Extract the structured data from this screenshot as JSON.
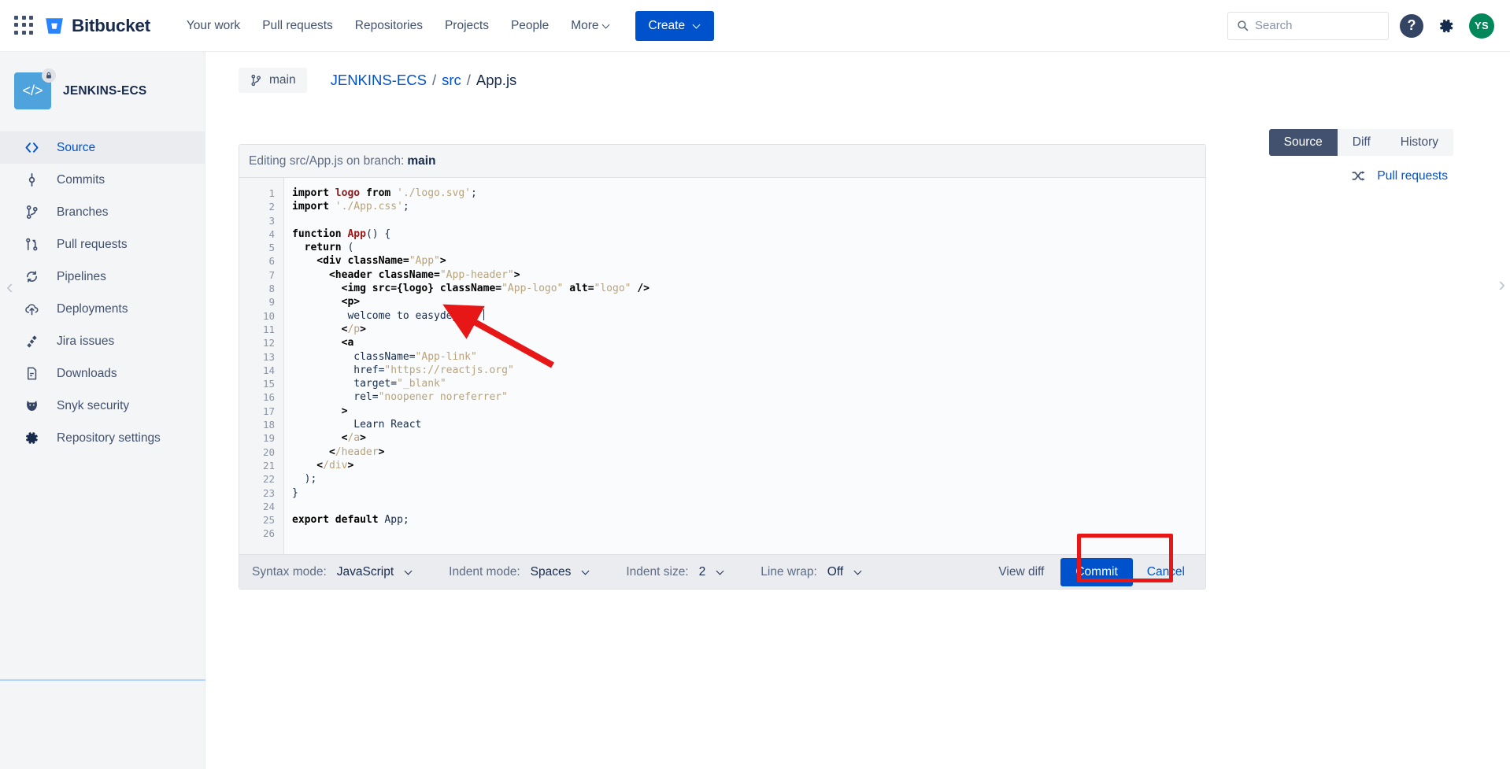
{
  "topnav": {
    "app_switcher_icon": "grid-apps-icon",
    "brand": "Bitbucket",
    "links": [
      {
        "label": "Your work"
      },
      {
        "label": "Pull requests"
      },
      {
        "label": "Repositories"
      },
      {
        "label": "Projects"
      },
      {
        "label": "People"
      },
      {
        "label": "More"
      }
    ],
    "create_label": "Create",
    "search_placeholder": "Search",
    "help_icon": "question-mark-icon",
    "settings_icon": "gear-icon",
    "avatar_initials": "YS"
  },
  "sidebar": {
    "repo_name": "JENKINS-ECS",
    "repo_avatar_glyph": "</>",
    "lock_icon": "lock-icon",
    "items": [
      {
        "label": "Source",
        "icon": "code-brackets-icon",
        "active": true
      },
      {
        "label": "Commits",
        "icon": "commit-node-icon",
        "active": false
      },
      {
        "label": "Branches",
        "icon": "branch-icon",
        "active": false
      },
      {
        "label": "Pull requests",
        "icon": "pull-request-icon",
        "active": false
      },
      {
        "label": "Pipelines",
        "icon": "pipeline-refresh-icon",
        "active": false
      },
      {
        "label": "Deployments",
        "icon": "cloud-upload-icon",
        "active": false
      },
      {
        "label": "Jira issues",
        "icon": "jira-icon",
        "active": false
      },
      {
        "label": "Downloads",
        "icon": "file-download-icon",
        "active": false
      },
      {
        "label": "Snyk security",
        "icon": "snyk-dog-icon",
        "active": false
      },
      {
        "label": "Repository settings",
        "icon": "gear-icon",
        "active": false
      }
    ]
  },
  "main": {
    "branch_label": "main",
    "branch_icon": "branch-icon",
    "breadcrumb": {
      "repo": "JENKINS-ECS",
      "folder": "src",
      "file": "App.js",
      "separator": "/"
    },
    "view_tabs": [
      {
        "label": "Source",
        "selected": true
      },
      {
        "label": "Diff",
        "selected": false
      },
      {
        "label": "History",
        "selected": false
      }
    ],
    "pull_requests_link": "Pull requests",
    "pull_requests_icon": "shuffle-arrows-icon"
  },
  "editor": {
    "header_prefix": "Editing src/App.js on branch:",
    "header_branch": "main",
    "line_numbers": [
      1,
      2,
      3,
      4,
      5,
      6,
      7,
      8,
      9,
      10,
      11,
      12,
      13,
      14,
      15,
      16,
      17,
      18,
      19,
      20,
      21,
      22,
      23,
      24,
      25,
      26
    ],
    "code_lines": [
      {
        "n": 1,
        "tokens": [
          {
            "t": "import",
            "c": "tk-kw"
          },
          {
            "t": " ",
            "c": "tk-plain"
          },
          {
            "t": "logo",
            "c": "tk-var"
          },
          {
            "t": " ",
            "c": "tk-plain"
          },
          {
            "t": "from",
            "c": "tk-kw"
          },
          {
            "t": " ",
            "c": "tk-plain"
          },
          {
            "t": "'./logo.svg'",
            "c": "tk-str"
          },
          {
            "t": ";",
            "c": "tk-plain"
          }
        ]
      },
      {
        "n": 2,
        "tokens": [
          {
            "t": "import",
            "c": "tk-kw"
          },
          {
            "t": " ",
            "c": "tk-plain"
          },
          {
            "t": "'./App.css'",
            "c": "tk-str"
          },
          {
            "t": ";",
            "c": "tk-plain"
          }
        ]
      },
      {
        "n": 3,
        "tokens": []
      },
      {
        "n": 4,
        "tokens": [
          {
            "t": "function",
            "c": "tk-kw"
          },
          {
            "t": " ",
            "c": "tk-plain"
          },
          {
            "t": "App",
            "c": "tk-fn"
          },
          {
            "t": "() {",
            "c": "tk-plain"
          }
        ]
      },
      {
        "n": 5,
        "tokens": [
          {
            "t": "  ",
            "c": "tk-plain"
          },
          {
            "t": "return",
            "c": "tk-kw"
          },
          {
            "t": " (",
            "c": "tk-plain"
          }
        ]
      },
      {
        "n": 6,
        "tokens": [
          {
            "t": "    <div className=",
            "c": "tk-tag"
          },
          {
            "t": "\"App\"",
            "c": "tk-str"
          },
          {
            "t": ">",
            "c": "tk-tag"
          }
        ]
      },
      {
        "n": 7,
        "tokens": [
          {
            "t": "      <header className=",
            "c": "tk-tag"
          },
          {
            "t": "\"App-header\"",
            "c": "tk-str"
          },
          {
            "t": ">",
            "c": "tk-tag"
          }
        ]
      },
      {
        "n": 8,
        "tokens": [
          {
            "t": "        <img src={logo} className=",
            "c": "tk-tag"
          },
          {
            "t": "\"App-logo\"",
            "c": "tk-str"
          },
          {
            "t": " alt=",
            "c": "tk-tag"
          },
          {
            "t": "\"logo\"",
            "c": "tk-str"
          },
          {
            "t": " />",
            "c": "tk-tag"
          }
        ]
      },
      {
        "n": 9,
        "tokens": [
          {
            "t": "        <p>",
            "c": "tk-tag"
          }
        ]
      },
      {
        "n": 10,
        "tokens": [
          {
            "t": "         welcome to easydeploy ",
            "c": "tk-plain"
          }
        ],
        "caret": true
      },
      {
        "n": 11,
        "tokens": [
          {
            "t": "        <",
            "c": "tk-tag"
          },
          {
            "t": "/p",
            "c": "tk-tagname"
          },
          {
            "t": ">",
            "c": "tk-tag"
          }
        ]
      },
      {
        "n": 12,
        "tokens": [
          {
            "t": "        <a",
            "c": "tk-tag"
          }
        ]
      },
      {
        "n": 13,
        "tokens": [
          {
            "t": "          className=",
            "c": "tk-attr"
          },
          {
            "t": "\"App-link\"",
            "c": "tk-str"
          }
        ]
      },
      {
        "n": 14,
        "tokens": [
          {
            "t": "          href=",
            "c": "tk-attr"
          },
          {
            "t": "\"https://reactjs.org\"",
            "c": "tk-str"
          }
        ]
      },
      {
        "n": 15,
        "tokens": [
          {
            "t": "          target=",
            "c": "tk-attr"
          },
          {
            "t": "\"_blank\"",
            "c": "tk-str"
          }
        ]
      },
      {
        "n": 16,
        "tokens": [
          {
            "t": "          rel=",
            "c": "tk-attr"
          },
          {
            "t": "\"noopener noreferrer\"",
            "c": "tk-str"
          }
        ]
      },
      {
        "n": 17,
        "tokens": [
          {
            "t": "        >",
            "c": "tk-tag"
          }
        ]
      },
      {
        "n": 18,
        "tokens": [
          {
            "t": "          Learn React",
            "c": "tk-plain"
          }
        ]
      },
      {
        "n": 19,
        "tokens": [
          {
            "t": "        <",
            "c": "tk-tag"
          },
          {
            "t": "/a",
            "c": "tk-tagname"
          },
          {
            "t": ">",
            "c": "tk-tag"
          }
        ]
      },
      {
        "n": 20,
        "tokens": [
          {
            "t": "      <",
            "c": "tk-tag"
          },
          {
            "t": "/header",
            "c": "tk-tagname"
          },
          {
            "t": ">",
            "c": "tk-tag"
          }
        ]
      },
      {
        "n": 21,
        "tokens": [
          {
            "t": "    <",
            "c": "tk-tag"
          },
          {
            "t": "/div",
            "c": "tk-tagname"
          },
          {
            "t": ">",
            "c": "tk-tag"
          }
        ]
      },
      {
        "n": 22,
        "tokens": [
          {
            "t": "  );",
            "c": "tk-plain"
          }
        ]
      },
      {
        "n": 23,
        "tokens": [
          {
            "t": "}",
            "c": "tk-plain"
          }
        ]
      },
      {
        "n": 24,
        "tokens": []
      },
      {
        "n": 25,
        "tokens": [
          {
            "t": "export",
            "c": "tk-kw"
          },
          {
            "t": " ",
            "c": "tk-plain"
          },
          {
            "t": "default",
            "c": "tk-kw"
          },
          {
            "t": " App;",
            "c": "tk-plain"
          }
        ]
      },
      {
        "n": 26,
        "tokens": []
      }
    ],
    "footer": {
      "syntax_mode_label": "Syntax mode:",
      "syntax_mode_value": "JavaScript",
      "indent_mode_label": "Indent mode:",
      "indent_mode_value": "Spaces",
      "indent_size_label": "Indent size:",
      "indent_size_value": "2",
      "line_wrap_label": "Line wrap:",
      "line_wrap_value": "Off",
      "view_diff_label": "View diff",
      "commit_label": "Commit",
      "cancel_label": "Cancel"
    }
  },
  "annotations": {
    "highlight_color": "#e81717",
    "arrow_color": "#e81717"
  },
  "colors": {
    "brand_blue": "#0052cc",
    "nav_text": "#42526e",
    "sidebar_bg": "#f4f5f7",
    "avatar_green": "#00875a",
    "repo_avatar_blue": "#4fa3dd"
  }
}
